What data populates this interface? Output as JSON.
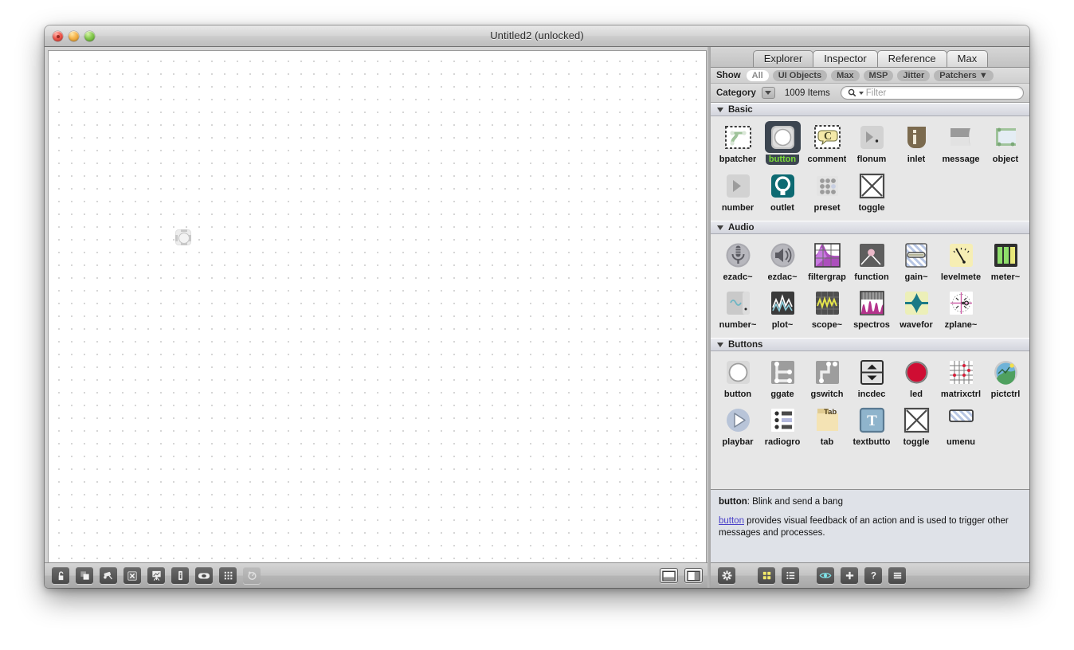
{
  "window": {
    "title": "Untitled2 (unlocked)",
    "traffic_lights": [
      "close-button",
      "minimize-button",
      "zoom-button"
    ]
  },
  "patcher": {
    "canvas_object": "button",
    "toolbar": {
      "buttons": [
        {
          "name": "unlock-patcher-button",
          "icon": "padlock-open-icon",
          "label": "Unlock"
        },
        {
          "name": "presentation-mode-button",
          "icon": "presentation-icon",
          "label": "Presentation Mode"
        },
        {
          "name": "view-options-button",
          "icon": "patching-view-icon",
          "label": "Patching View"
        },
        {
          "name": "close-x-button",
          "icon": "x-box-icon",
          "label": "X"
        },
        {
          "name": "debug-button",
          "icon": "easel-icon",
          "label": "Debug"
        },
        {
          "name": "inspector-button",
          "icon": "info-i-icon",
          "label": "Inspector"
        },
        {
          "name": "object-palette-button",
          "icon": "oval-icon",
          "label": "Palette"
        },
        {
          "name": "grid-snap-button",
          "icon": "grid-dots-icon",
          "label": "Grid"
        },
        {
          "name": "audio-status-button",
          "icon": "audio-dial-icon",
          "label": "Audio"
        }
      ],
      "right_buttons": [
        {
          "name": "sidebar-bottom-toggle",
          "icon": "pane-bottom-icon",
          "label": "Bottom Pane"
        },
        {
          "name": "sidebar-right-toggle",
          "icon": "pane-right-icon",
          "label": "Right Pane"
        }
      ]
    }
  },
  "sidebar": {
    "tabs": [
      {
        "label": "Explorer",
        "active": true
      },
      {
        "label": "Inspector",
        "active": false
      },
      {
        "label": "Reference",
        "active": false
      },
      {
        "label": "Max",
        "active": false
      }
    ],
    "show": {
      "label": "Show",
      "filters": [
        {
          "label": "All",
          "active": true
        },
        {
          "label": "UI Objects",
          "active": false
        },
        {
          "label": "Max",
          "active": false
        },
        {
          "label": "MSP",
          "active": false
        },
        {
          "label": "Jitter",
          "active": false
        },
        {
          "label": "Patchers ▼",
          "active": false
        }
      ]
    },
    "category": {
      "label": "Category",
      "item_count": "1009 Items",
      "search_placeholder": "Filter",
      "search_value": ""
    },
    "sections": [
      {
        "title": "Basic",
        "items": [
          {
            "label": "bpatcher",
            "icon": "bpatcher-icon",
            "selected": false
          },
          {
            "label": "button",
            "icon": "button-icon",
            "selected": true
          },
          {
            "label": "comment",
            "icon": "comment-icon",
            "selected": false
          },
          {
            "label": "flonum",
            "icon": "flonum-icon",
            "selected": false
          },
          {
            "label": "inlet",
            "icon": "inlet-icon",
            "selected": false
          },
          {
            "label": "message",
            "icon": "message-icon",
            "selected": false
          },
          {
            "label": "object",
            "icon": "object-icon",
            "selected": false
          },
          {
            "label": "number",
            "icon": "number-icon",
            "selected": false
          },
          {
            "label": "outlet",
            "icon": "outlet-icon",
            "selected": false
          },
          {
            "label": "preset",
            "icon": "preset-icon",
            "selected": false
          },
          {
            "label": "toggle",
            "icon": "toggle-icon",
            "selected": false
          }
        ]
      },
      {
        "title": "Audio",
        "items": [
          {
            "label": "ezadc~",
            "icon": "ezadc-microphone-icon",
            "selected": false
          },
          {
            "label": "ezdac~",
            "icon": "ezdac-speaker-icon",
            "selected": false
          },
          {
            "label": "filtergrap",
            "icon": "filtergraph-icon",
            "selected": false
          },
          {
            "label": "function",
            "icon": "function-curve-icon",
            "selected": false
          },
          {
            "label": "gain~",
            "icon": "gain-slider-icon",
            "selected": false
          },
          {
            "label": "levelmete",
            "icon": "levelmeter-dial-icon",
            "selected": false
          },
          {
            "label": "meter~",
            "icon": "meter-bars-icon",
            "selected": false
          },
          {
            "label": "number~",
            "icon": "number-tilde-icon",
            "selected": false
          },
          {
            "label": "plot~",
            "icon": "plot-lines-icon",
            "selected": false
          },
          {
            "label": "scope~",
            "icon": "scope-wave-icon",
            "selected": false
          },
          {
            "label": "spectros",
            "icon": "spectroscope-icon",
            "selected": false
          },
          {
            "label": "wavefor",
            "icon": "waveform-icon",
            "selected": false
          },
          {
            "label": "zplane~",
            "icon": "zplane-icon",
            "selected": false
          }
        ]
      },
      {
        "title": "Buttons",
        "items": [
          {
            "label": "button",
            "icon": "button-circle-icon",
            "selected": false
          },
          {
            "label": "ggate",
            "icon": "ggate-icon",
            "selected": false
          },
          {
            "label": "gswitch",
            "icon": "gswitch-icon",
            "selected": false
          },
          {
            "label": "incdec",
            "icon": "incdec-arrows-icon",
            "selected": false
          },
          {
            "label": "led",
            "icon": "led-red-icon",
            "selected": false
          },
          {
            "label": "matrixctrl",
            "icon": "matrixctrl-grid-icon",
            "selected": false
          },
          {
            "label": "pictctrl",
            "icon": "pictctrl-image-icon",
            "selected": false
          },
          {
            "label": "playbar",
            "icon": "playbar-play-icon",
            "selected": false
          },
          {
            "label": "radiogro",
            "icon": "radiogroup-list-icon",
            "selected": false
          },
          {
            "label": "tab",
            "icon": "tab-folder-icon",
            "selected": false
          },
          {
            "label": "textbutto",
            "icon": "textbutton-t-icon",
            "selected": false
          },
          {
            "label": "toggle",
            "icon": "toggle-x-icon",
            "selected": false
          },
          {
            "label": "umenu",
            "icon": "umenu-striped-icon",
            "selected": false
          }
        ]
      }
    ],
    "description": {
      "name": "button",
      "summary": ": Blink and send a bang",
      "link_text": "button",
      "body": " provides visual feedback of an action and is used to trigger other messages and processes."
    },
    "bottom_toolbar": [
      {
        "name": "action-gear-button",
        "icon": "gear-icon",
        "label": "Actions"
      },
      {
        "name": "icon-view-button",
        "icon": "grid-view-icon",
        "label": "Icon View"
      },
      {
        "name": "list-view-button",
        "icon": "list-view-icon",
        "label": "List View"
      },
      {
        "name": "preview-button",
        "icon": "eye-icon",
        "label": "Preview"
      },
      {
        "name": "add-button",
        "icon": "plus-icon",
        "label": "Add"
      },
      {
        "name": "help-button",
        "icon": "question-mark-icon",
        "label": "Help"
      },
      {
        "name": "menu-button",
        "icon": "hamburger-menu-icon",
        "label": "Menu"
      }
    ]
  },
  "colors": {
    "selection_bg": "#3c4550",
    "selection_text": "#7bdc3a",
    "link": "#4a41c8",
    "desc_bg": "#dfe2e8",
    "browser_bg": "#e7e7e7"
  }
}
